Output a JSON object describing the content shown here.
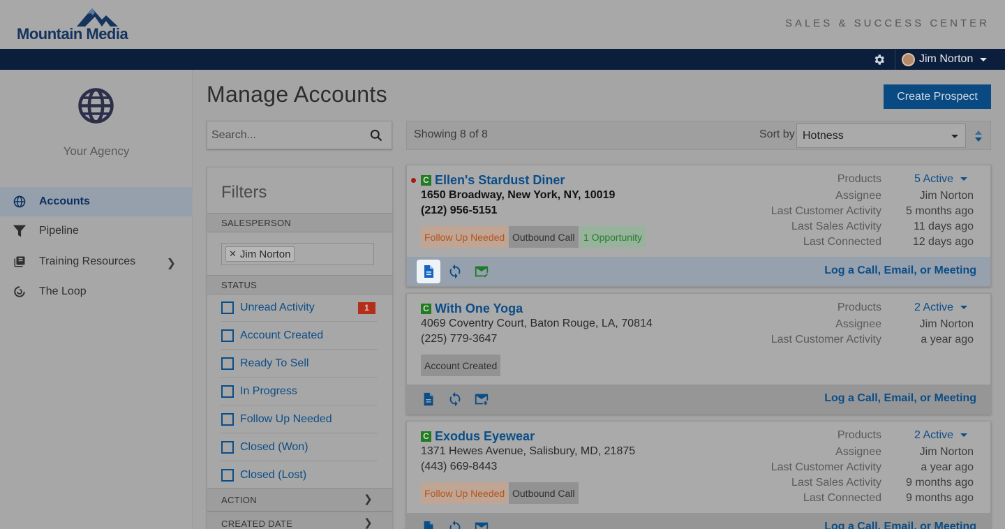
{
  "brand": {
    "name": "Mountain Media",
    "center_title": "SALES & SUCCESS CENTER"
  },
  "navbar": {
    "user_name": "Jim Norton"
  },
  "sidebar": {
    "agency_name": "Your Agency",
    "items": [
      {
        "label": "Accounts"
      },
      {
        "label": "Pipeline"
      },
      {
        "label": "Training Resources"
      },
      {
        "label": "The Loop"
      }
    ]
  },
  "main": {
    "title": "Manage Accounts",
    "create_button": "Create Prospect",
    "search_placeholder": "Search...",
    "showing": "Showing 8 of 8",
    "sort_label": "Sort by",
    "sort_value": "Hotness"
  },
  "filters": {
    "title": "Filters",
    "salesperson_head": "SALESPERSON",
    "salesperson_tag": "Jim Norton",
    "status_head": "STATUS",
    "statuses": [
      {
        "label": "Unread Activity",
        "count": "1"
      },
      {
        "label": "Account Created"
      },
      {
        "label": "Ready To Sell"
      },
      {
        "label": "In Progress"
      },
      {
        "label": "Follow Up Needed"
      },
      {
        "label": "Closed (Won)"
      },
      {
        "label": "Closed (Lost)"
      }
    ],
    "action_head": "ACTION",
    "created_head": "CREATED DATE"
  },
  "cards": [
    {
      "badge": "C",
      "name": "Ellen's Stardust Diner",
      "address": "1650 Broadway, New York, NY, 10019",
      "phone": "(212) 956-5151",
      "tags": [
        "Follow Up Needed",
        "Outbound Call",
        "1 Opportunity"
      ],
      "products_label": "Products",
      "products_value": "5 Active",
      "assignee_label": "Assignee",
      "assignee_value": "Jim Norton",
      "lca_label": "Last Customer Activity",
      "lca_value": "5 months ago",
      "lsa_label": "Last Sales Activity",
      "lsa_value": "11 days ago",
      "lc_label": "Last Connected",
      "lc_value": "12 days ago",
      "log_link": "Log a Call, Email, or Meeting"
    },
    {
      "badge": "C",
      "name": "With One Yoga",
      "address": "4069 Coventry Court, Baton Rouge, LA, 70814",
      "phone": "(225) 779-3647",
      "tags": [
        "Account Created"
      ],
      "products_label": "Products",
      "products_value": "2 Active",
      "assignee_label": "Assignee",
      "assignee_value": "Jim Norton",
      "lca_label": "Last Customer Activity",
      "lca_value": "a year ago",
      "log_link": "Log a Call, Email, or Meeting"
    },
    {
      "badge": "C",
      "name": "Exodus Eyewear",
      "address": "1371 Hewes Avenue, Salisbury, MD, 21875",
      "phone": "(443) 669-8443",
      "tags": [
        "Follow Up Needed",
        "Outbound Call"
      ],
      "products_label": "Products",
      "products_value": "2 Active",
      "assignee_label": "Assignee",
      "assignee_value": "Jim Norton",
      "lca_label": "Last Customer Activity",
      "lca_value": "a year ago",
      "lsa_label": "Last Sales Activity",
      "lsa_value": "9 months ago",
      "lc_label": "Last Connected",
      "lc_value": "9 months ago",
      "log_link": "Log a Call, Email, or Meeting"
    }
  ]
}
